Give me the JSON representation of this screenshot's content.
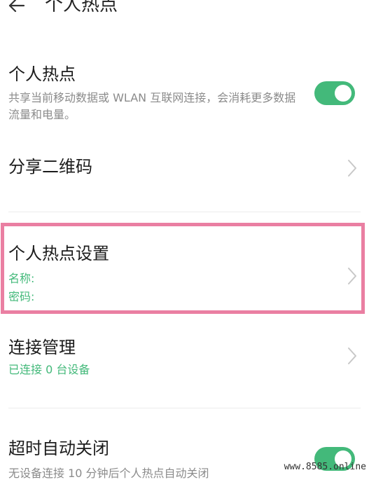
{
  "header": {
    "title": "个人热点"
  },
  "hotspot_row": {
    "title": "个人热点",
    "subtitle": "共享当前移动数据或 WLAN 互联网连接，会消耗更多数据流量和电量。",
    "toggle_state": "on"
  },
  "qr_row": {
    "title": "分享二维码"
  },
  "settings_row": {
    "title": "个人热点设置",
    "name_label": "名称:",
    "password_label": "密码:"
  },
  "connection_row": {
    "title": "连接管理",
    "subtitle": "已连接 0 台设备"
  },
  "timeout_row": {
    "title": "超时自动关闭",
    "subtitle": "无设备连接 10 分钟后个人热点自动关闭",
    "toggle_state": "on"
  },
  "watermark": "www.8585.online",
  "colors": {
    "accent": "#43b97a",
    "highlight": "#ea7fa2"
  }
}
